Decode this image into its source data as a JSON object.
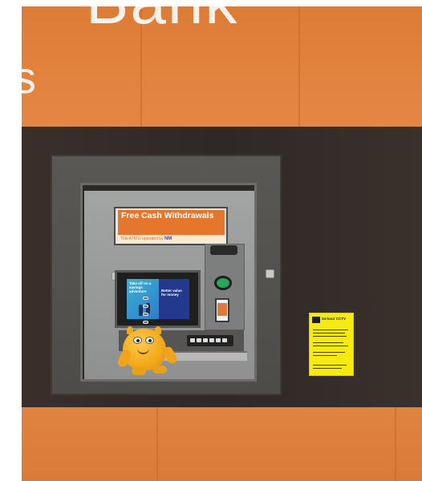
{
  "signage": {
    "bank_name_partial": "Bank",
    "side_letter": "s"
  },
  "atm": {
    "header_sign": {
      "title": "Free Cash Withdrawals",
      "subtitle": "This ATM is operated by",
      "operator_logo": "NM"
    },
    "screen": {
      "left_text": "Take off on a savings adventure",
      "right_text": "Better value for money"
    }
  },
  "notice": {
    "title": "24-hour CCTV"
  },
  "colors": {
    "orange_wall": "#e0813a",
    "dark_band": "#2f2825",
    "sign_orange": "#e6762b",
    "notice_yellow": "#f7ea10",
    "green_button": "#2aa65a",
    "toy_yellow": "#f2a91a"
  },
  "objects": {
    "toy": "plush-monster",
    "icons": [
      "cctv-icon",
      "green-button-icon",
      "card-slot-icon"
    ]
  }
}
